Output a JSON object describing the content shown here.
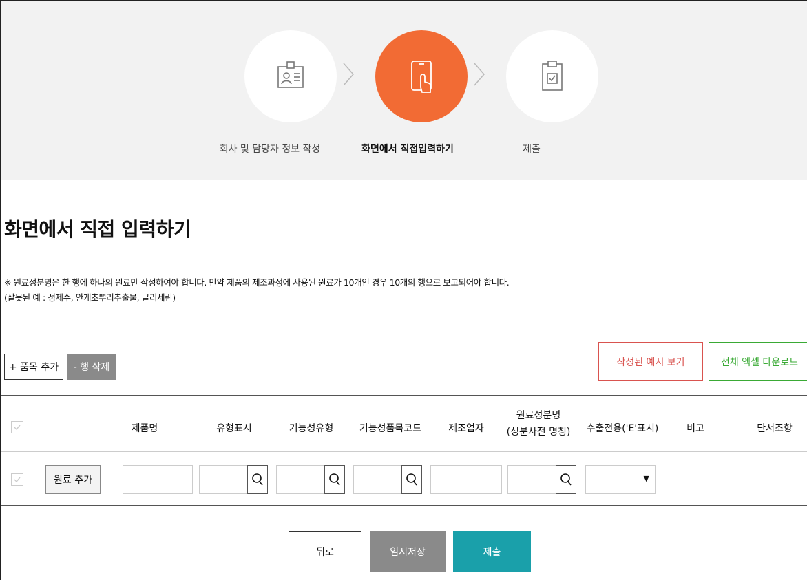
{
  "steps": [
    {
      "label": "회사 및 담당자 정보 작성",
      "icon": "id-card-icon",
      "active": false
    },
    {
      "label": "화면에서 직접입력하기",
      "icon": "tablet-touch-icon",
      "active": true
    },
    {
      "label": "제출",
      "icon": "clipboard-check-icon",
      "active": false
    }
  ],
  "page": {
    "title": "화면에서 직접 입력하기",
    "notice_line1": "※ 원료성분명은 한 행에 하나의 원료만 작성하여야 합니다. 만약 제품의 제조과정에 사용된 원료가 10개인 경우 10개의 행으로 보고되어야 합니다.",
    "notice_line2": "(잘못된 예 : 정제수, 안개초뿌리추출물, 글리세린)"
  },
  "toolbar": {
    "add_item": "+ 품목 추가",
    "delete_row": "- 행 삭제",
    "view_example": "작성된 예시 보기",
    "download_excel": "전체 엑셀 다운로드"
  },
  "table": {
    "headers": {
      "product_name": "제품명",
      "type_display": "유형표시",
      "functional_type": "기능성유형",
      "functional_code": "기능성품목코드",
      "manufacturer": "제조업자",
      "ingredient_line1": "원료성분명",
      "ingredient_line2": "(성분사전 명칭)",
      "export_only": "수출전용('E'표시)",
      "remark": "비고",
      "proviso": "단서조항"
    },
    "row": {
      "add_material": "원료 추가",
      "export_select_value": ""
    }
  },
  "footer": {
    "back": "뒤로",
    "temp_save": "임시저장",
    "submit": "제출"
  },
  "colors": {
    "active_step": "#f26b34",
    "submit": "#1aa0aa",
    "example_border": "#d9534f",
    "excel_border": "#3aaa35"
  }
}
